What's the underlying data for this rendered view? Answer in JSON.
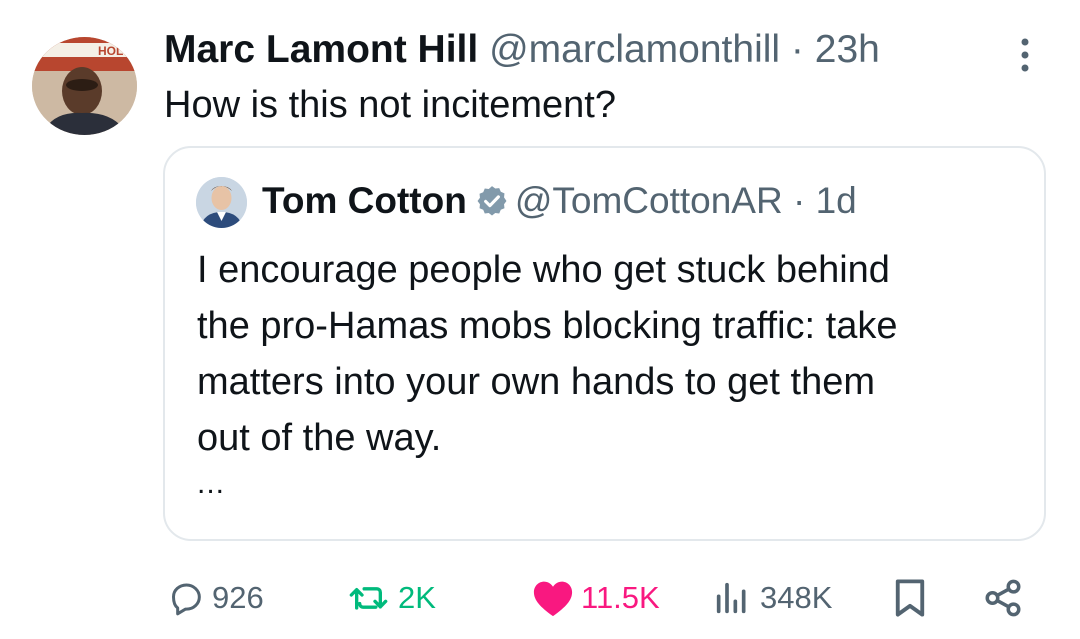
{
  "tweet": {
    "author": {
      "name": "Marc Lamont Hill",
      "handle": "@marclamonthill",
      "avatar_sign_text": "HOL"
    },
    "separator": "·",
    "time": "23h",
    "text": "How is this not incitement?",
    "more_icon": "more-vertical-icon"
  },
  "quote": {
    "author": {
      "name": "Tom Cotton",
      "handle": "@TomCottonAR",
      "verified": true,
      "verified_icon": "verified-badge-icon"
    },
    "separator": "·",
    "time": "1d",
    "text_lines": [
      "I encourage people who get stuck behind",
      "the pro-Hamas mobs blocking traffic: take",
      "matters into your own hands to get them",
      "out of the way."
    ],
    "ellipsis": "..."
  },
  "actions": {
    "replies": {
      "icon": "reply-icon",
      "count": "926"
    },
    "retweets": {
      "icon": "retweet-icon",
      "count": "2K",
      "active": true
    },
    "likes": {
      "icon": "heart-icon",
      "count": "11.5K",
      "active": true
    },
    "views": {
      "icon": "views-icon",
      "count": "348K"
    },
    "bookmark": {
      "icon": "bookmark-icon"
    },
    "share": {
      "icon": "share-icon"
    }
  },
  "colors": {
    "text": "#0f1419",
    "secondary": "#536471",
    "retweet_active": "#00ba7c",
    "like_active": "#f91880",
    "verified": "#829aab",
    "card_border": "#e3e8ec"
  }
}
